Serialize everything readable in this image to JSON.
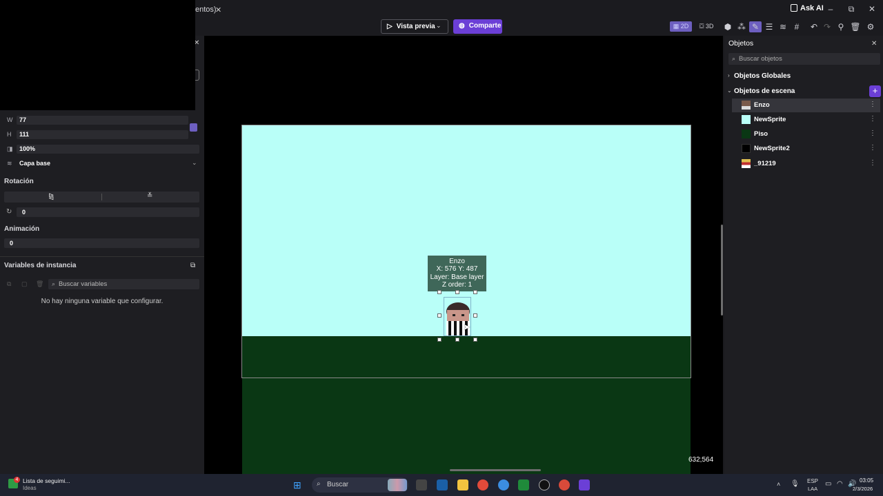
{
  "window": {
    "tab_fragment": "entos)",
    "ask_ai": "Ask AI"
  },
  "toolbar": {
    "preview_label": "Vista previa",
    "share_label": "Comparte",
    "toggle_2d": "2D",
    "toggle_3d": "3D"
  },
  "left_panel": {
    "w_label": "W",
    "w_value": "77",
    "h_label": "H",
    "h_value": "111",
    "opacity": "100%",
    "layer": "Capa base",
    "rotation_title": "Rotación",
    "rotation_value": "0",
    "animation_title": "Animación",
    "animation_value": "0",
    "instance_vars_title": "Variables de instancia",
    "search_vars_placeholder": "Buscar variables",
    "no_vars_msg": "No hay ninguna variable que configurar."
  },
  "canvas": {
    "tooltip": {
      "name": "Enzo",
      "pos": "X: 576  Y: 487",
      "layer": "Layer: Base layer",
      "zorder": "Z order: 1"
    },
    "cursor_coords": "632;564",
    "colors": {
      "sky": "#b9fff8",
      "floor": "#0a3714"
    }
  },
  "right_panel": {
    "title": "Objetos",
    "search_placeholder": "Buscar objetos",
    "global_objects": "Objetos Globales",
    "scene_objects": "Objetos de escena",
    "objects": [
      {
        "name": "Enzo",
        "thumb": "sprite-icon",
        "color": "#7a5a4a"
      },
      {
        "name": "NewSprite",
        "thumb": "color-swatch",
        "color": "#b9fff8"
      },
      {
        "name": "Piso",
        "thumb": "color-swatch",
        "color": "#0a3714"
      },
      {
        "name": "NewSprite2",
        "thumb": "color-swatch",
        "color": "#000000"
      },
      {
        "name": "_91219",
        "thumb": "sprite-icon",
        "color": "#e0c050"
      }
    ],
    "accent": "#6b3fd6"
  },
  "taskbar": {
    "news_title": "Lista de seguimi...",
    "news_sub": "Ideas",
    "search": "Buscar",
    "lang": "ESP",
    "lang_sub": "LAA",
    "time": "03:05",
    "date": "2/3/2026",
    "badge": "4"
  }
}
